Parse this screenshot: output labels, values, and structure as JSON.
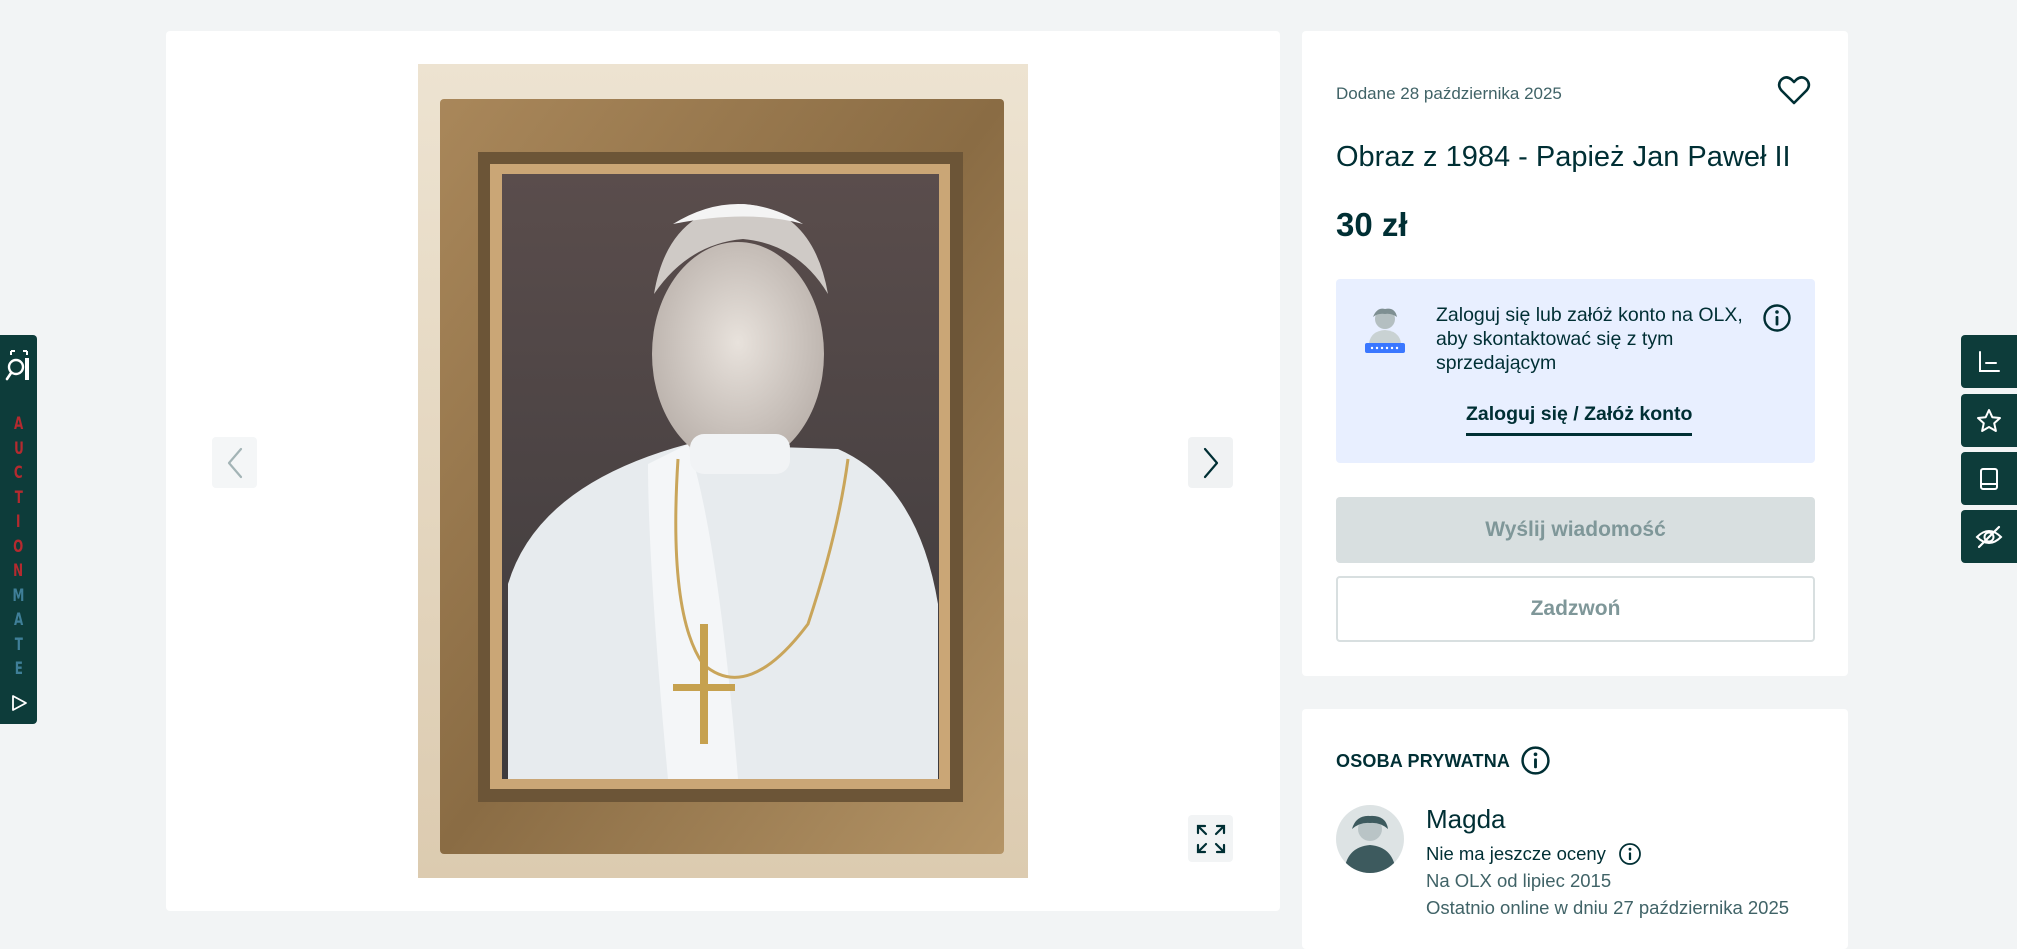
{
  "listing": {
    "date": "Dodane 28 października 2025",
    "title": "Obraz z 1984 - Papież Jan Paweł II",
    "price": "30 zł"
  },
  "login_prompt": {
    "text": "Zaloguj się lub załóż konto na OLX, aby skontaktować się z tym sprzedającym",
    "link_label": "Zaloguj się / Załóż konto"
  },
  "actions": {
    "message_label": "Wyślij wiadomość",
    "call_label": "Zadzwoń"
  },
  "seller": {
    "type": "OSOBA PRYWATNA",
    "name": "Magda",
    "rating": "Nie ma jeszcze oceny",
    "member_since": "Na OLX od lipiec 2015",
    "last_online": "Ostatnio online w dniu 27 października 2025"
  },
  "extension": {
    "letters": [
      "A",
      "U",
      "C",
      "T",
      "I",
      "O",
      "N",
      "M",
      "A",
      "T",
      "E"
    ],
    "letter_colors": [
      "#b52a2f",
      "#b52a2f",
      "#b52a2f",
      "#b52a2f",
      "#b52a2f",
      "#b52a2f",
      "#b52a2f",
      "#3f7f98",
      "#3f7f98",
      "#3f7f98",
      "#3f7f98"
    ]
  },
  "icons": {
    "gallery_prev": "chevron-left-icon",
    "gallery_next": "chevron-right-icon",
    "fullscreen": "expand-icon",
    "favorite": "heart-icon",
    "info": "info-icon",
    "right_toolbar": [
      "chart-icon",
      "star-icon",
      "book-icon",
      "eye-off-icon"
    ]
  },
  "colors": {
    "brand_dark": "#002f34",
    "login_box_bg": "#e8efff",
    "disabled_button_bg": "#d8dfe0",
    "extension_bg": "#0d3c3a"
  }
}
